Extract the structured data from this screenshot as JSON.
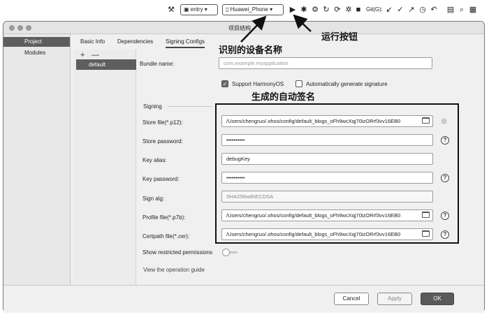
{
  "toolbar": {
    "module_select": "entry",
    "device_select": "Huawei_Phone",
    "git_label": "Git(G):"
  },
  "dialog": {
    "title": "项目结构",
    "left_nav": [
      {
        "label": "Project",
        "selected": true
      },
      {
        "label": "Modules",
        "selected": false
      }
    ],
    "tabs": [
      {
        "label": "Basic Info",
        "active": false
      },
      {
        "label": "Dependencies",
        "active": false
      },
      {
        "label": "Signing Configs",
        "active": true
      }
    ],
    "product_add": "+",
    "product_remove": "—",
    "products": [
      "default"
    ],
    "bundle_name_label": "Bundle name:",
    "bundle_name_placeholder": "com.example.myapplication",
    "support_harmonyos_label": "Support HarmonyOS",
    "support_harmonyos_checked": true,
    "auto_sign_label": "Automatically generate signature",
    "auto_sign_checked": false,
    "signing_section": "Signing",
    "fields": {
      "store_file_label": "Store file(*.p12):",
      "store_file_value": "/Users/chengruo/.ohos/config/default_blogs_oFh9wcXqj70izORrf3vv16EB0",
      "store_password_label": "Store password:",
      "store_password_value": "••••••••••",
      "key_alias_label": "Key alias:",
      "key_alias_value": "debugKey",
      "key_password_label": "Key password:",
      "key_password_value": "••••••••••",
      "sign_alg_label": "Sign alg:",
      "sign_alg_value": "SHA256withECDSA",
      "profile_file_label": "Profile file(*.p7b):",
      "profile_file_value": "/Users/chengruo/.ohos/config/default_blogs_oFh9wcXqj70izORrf3vv16EB0",
      "certpath_file_label": "Certpath file(*.cer):",
      "certpath_file_value": "/Users/chengruo/.ohos/config/default_blogs_oFh9wcXqj70izORrf3vv16EB0"
    },
    "help_icon_glyph": "?",
    "show_restricted_label": "Show restricted permissions",
    "show_restricted_on": false,
    "operation_guide_link": "View the operation guide",
    "buttons": {
      "cancel": "Cancel",
      "apply": "Apply",
      "ok": "OK"
    }
  },
  "annotations": {
    "device_name": "识别的设备名称",
    "run_button": "运行按钮",
    "auto_signature": "生成的自动签名"
  },
  "colors": {
    "selection": "#5e5e5e",
    "dialog_bg": "#f0f0f0",
    "primary_button": "#5a5a5a"
  }
}
